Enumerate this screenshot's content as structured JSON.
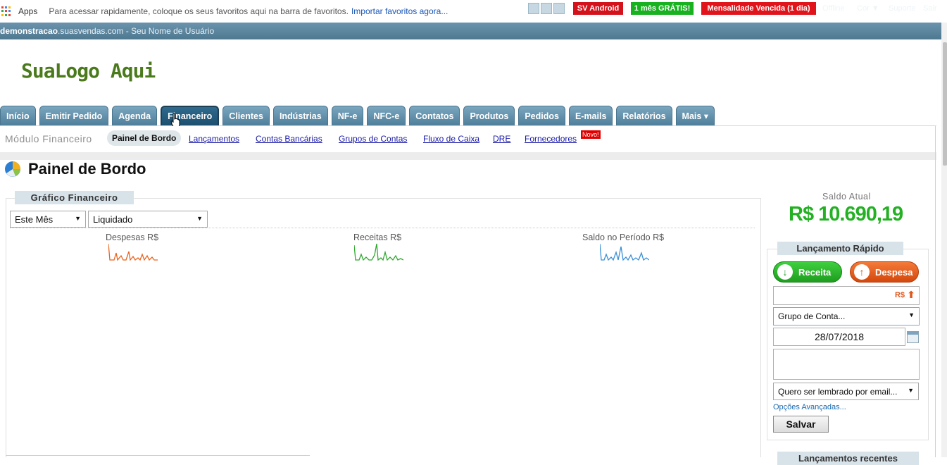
{
  "browser": {
    "apps_label": "Apps",
    "bookmark_hint": "Para acessar rapidamente, coloque os seus favoritos aqui na barra de favoritos.",
    "import_link": "Importar favoritos agora..."
  },
  "topbar": {
    "domain_bold": "demonstracao",
    "domain_rest": ".suasvendas.com - Seu Nome de Usuário",
    "android_button": "SV Android",
    "free_month_button": "1 mês GRÁTIS!",
    "expired_button": "Mensalidade Vencida (1 dia)",
    "offline_label": "Offline",
    "color_menu": "Cor ▼",
    "support_link": "Suporte",
    "logout_link": "Sair"
  },
  "logo_text": "SuaLogo Aqui",
  "tabs": [
    {
      "label": "Início"
    },
    {
      "label": "Emitir Pedido"
    },
    {
      "label": "Agenda"
    },
    {
      "label": "Financeiro",
      "active": true
    },
    {
      "label": "Clientes"
    },
    {
      "label": "Indústrias"
    },
    {
      "label": "NF-e"
    },
    {
      "label": "NFC-e"
    },
    {
      "label": "Contatos"
    },
    {
      "label": "Produtos"
    },
    {
      "label": "Pedidos"
    },
    {
      "label": "E-mails"
    },
    {
      "label": "Relatórios"
    },
    {
      "label": "Mais ▾"
    }
  ],
  "subnav": {
    "module_label": "Módulo Financeiro",
    "active": "Painel de Bordo",
    "links": [
      "Lançamentos",
      "Contas Bancárias",
      "Grupos de Contas",
      "Fluxo de Caixa",
      "DRE",
      "Fornecedores"
    ],
    "new_badge": "Novo!"
  },
  "page_title": "Painel de Bordo",
  "chart_panel": {
    "title": "Gráfico Financeiro",
    "period_select": "Este Mês",
    "status_select": "Liquidado",
    "sparklines": [
      {
        "label": "Despesas R$",
        "color": "#e8641e"
      },
      {
        "label": "Receitas R$",
        "color": "#2fa82f"
      },
      {
        "label": "Saldo no Período R$",
        "color": "#3a8fd6"
      }
    ]
  },
  "saldo": {
    "label": "Saldo Atual",
    "value": "R$ 10.690,19",
    "color": "#23b023"
  },
  "quick_entry": {
    "title": "Lançamento Rápido",
    "receita_button": "Receita",
    "despesa_button": "Despesa",
    "currency_label": "R$",
    "grupo_select": "Grupo de Conta...",
    "date_value": "28/07/2018",
    "reminder_select": "Quero ser lembrado por email...",
    "advanced_link": "Opções Avançadas...",
    "save_button": "Salvar"
  },
  "recent_title": "Lançamentos recentes"
}
